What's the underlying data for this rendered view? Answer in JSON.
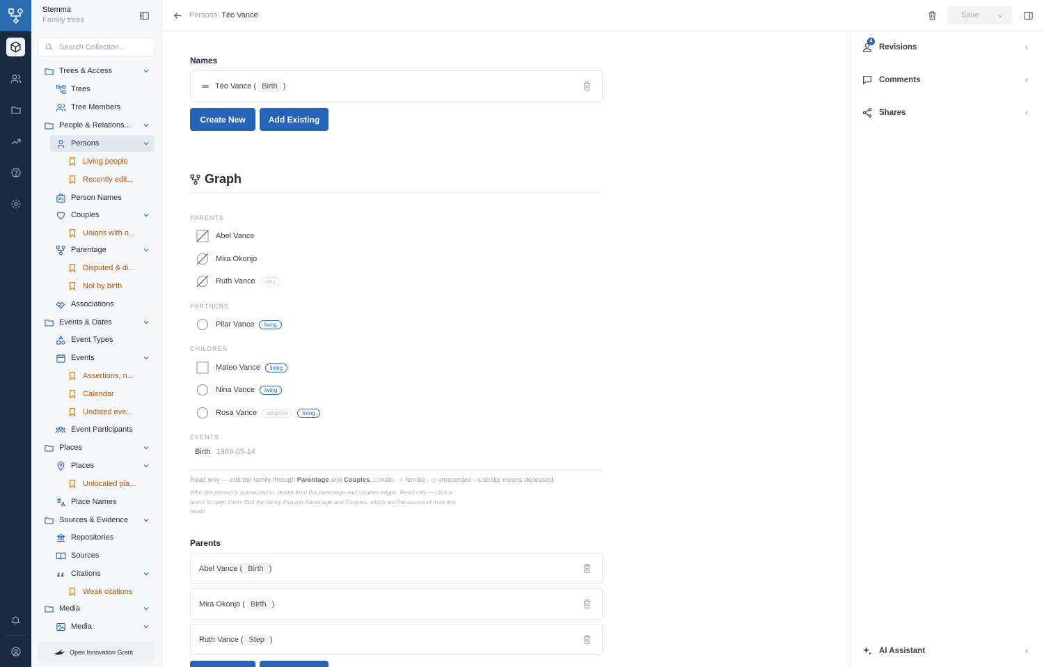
{
  "app": {
    "name": "Stemma",
    "subtitle": "Family trees"
  },
  "search": {
    "placeholder": "Search Collection..."
  },
  "nav": [
    {
      "label": "Trees & Access"
    },
    {
      "label": "Trees"
    },
    {
      "label": "Tree Members"
    },
    {
      "label": "People & Relations..."
    },
    {
      "label": "Persons"
    },
    {
      "label": "Living people"
    },
    {
      "label": "Recently edit..."
    },
    {
      "label": "Person Names"
    },
    {
      "label": "Couples"
    },
    {
      "label": "Unions with n..."
    },
    {
      "label": "Parentage"
    },
    {
      "label": "Disputed & di..."
    },
    {
      "label": "Not by birth"
    },
    {
      "label": "Associations"
    },
    {
      "label": "Events & Dates"
    },
    {
      "label": "Event Types"
    },
    {
      "label": "Events"
    },
    {
      "label": "Assertions, n..."
    },
    {
      "label": "Calendar"
    },
    {
      "label": "Undated eve..."
    },
    {
      "label": "Event Participants"
    },
    {
      "label": "Places"
    },
    {
      "label": "Places"
    },
    {
      "label": "Unlocated pla..."
    },
    {
      "label": "Place Names"
    },
    {
      "label": "Sources & Evidence"
    },
    {
      "label": "Repositories"
    },
    {
      "label": "Sources"
    },
    {
      "label": "Citations"
    },
    {
      "label": "Weak citations"
    },
    {
      "label": "Media"
    },
    {
      "label": "Media"
    }
  ],
  "grant": {
    "label": "Open Innovation Grant"
  },
  "breadcrumb": {
    "parent": "Persons:",
    "current": "Téo Vance"
  },
  "toolbar": {
    "save_label": "Save"
  },
  "names": {
    "heading": "Names",
    "items": [
      {
        "name": "Téo Vance (",
        "type": "Birth",
        "close": ")"
      }
    ],
    "create_label": "Create New",
    "add_label": "Add Existing"
  },
  "graph": {
    "title": "Graph",
    "parents_label": "PARENTS",
    "parents": [
      {
        "name": "Abel Vance",
        "tag": ""
      },
      {
        "name": "Mira Okonjo",
        "tag": ""
      },
      {
        "name": "Ruth Vance",
        "tag": "step"
      }
    ],
    "partners_label": "PARTNERS",
    "partners": [
      {
        "name": "Pilar Vance",
        "tag": "living"
      }
    ],
    "children_label": "CHILDREN",
    "children": [
      {
        "name": "Mateo Vance",
        "tag": "living"
      },
      {
        "name": "Nina Vance",
        "tag": "living"
      },
      {
        "name": "Rosa Vance",
        "tag1": "adoptive",
        "tag2": "living"
      }
    ],
    "events_label": "EVENTS",
    "events": [
      {
        "type": "Birth",
        "date": "1969-05-14"
      }
    ],
    "note_pre": "Read only — edit the family through ",
    "note_link1": "Parentage",
    "note_mid": " and ",
    "note_link2": "Couples",
    "note_post": ". □ male · ○ female · ◇ unrecorded · a stroke means deceased.",
    "help": "Who this person is connected to, drawn from the parentage and couples edges. Read only — click a name to open them. Edit the family through Parentage and Couples, which are the source of truth this reads."
  },
  "parents_section": {
    "heading": "Parents",
    "items": [
      {
        "name": "Abel Vance (",
        "type": "Birth",
        "close": ")"
      },
      {
        "name": "Mira Okonjo (",
        "type": "Birth",
        "close": ")"
      },
      {
        "name": "Ruth Vance (",
        "type": "Step",
        "close": ")"
      }
    ]
  },
  "right_panel": {
    "revisions": "Revisions",
    "revisions_count": "4",
    "comments": "Comments",
    "shares": "Shares",
    "ai": "AI Assistant"
  },
  "colors": {
    "accent": "#2563b8",
    "rail": "#1a2a40",
    "logo_bg": "#2b6cb0",
    "folder_orange": "#b45309"
  }
}
